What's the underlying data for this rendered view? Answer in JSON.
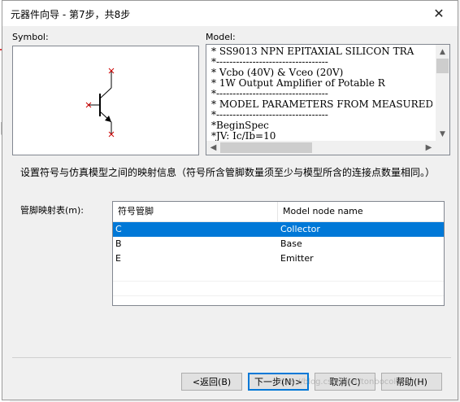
{
  "window": {
    "title": "元器件向导 - 第7步，共8步",
    "close_glyph": "✕"
  },
  "symbol": {
    "label": "Symbol:",
    "pins": [
      "C",
      "B",
      "E"
    ],
    "pin_marker_color": "#cc0000"
  },
  "model": {
    "label": "Model:",
    "text": "* SS9013 NPN EPITAXIAL SILICON TRA\n*----------------------------------\n* Vcbo (40V) & Vceo (20V)\n* 1W Output Amplifier of Potable R\n*----------------------------------\n* MODEL PARAMETERS FROM MEASURED D\n*----------------------------------\n*BeginSpec\n*JV: Ic/Ib=10"
  },
  "instruction": "设置符号与仿真模型之间的映射信息（符号所含管脚数量须至少与模型所含的连接点数量相同。）",
  "mapping": {
    "label": "管脚映射表(m):",
    "headers": [
      "符号管脚",
      "Model node name"
    ],
    "rows": [
      {
        "pin": "C",
        "node": "Collector",
        "selected": true
      },
      {
        "pin": "B",
        "node": "Base",
        "selected": false
      },
      {
        "pin": "E",
        "node": "Emitter",
        "selected": false
      }
    ]
  },
  "buttons": {
    "back": "<返回(B)",
    "next": "下一步(N)>",
    "cancel": "取消(C)",
    "help": "帮助(H)"
  },
  "colors": {
    "selection": "#0078d7",
    "default_button_border": "#0078d7"
  },
  "watermark": "https://blog.csdn.net/tonbocolorg"
}
